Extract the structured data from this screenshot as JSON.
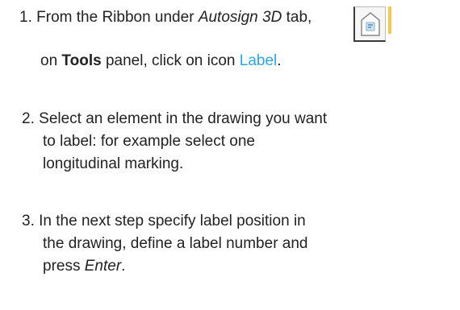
{
  "steps": [
    {
      "number": "1.",
      "line1_prefix": "From the Ribbon under ",
      "line1_tab": "Autosign 3D",
      "line1_suffix": " tab,",
      "line2_prefix": "on ",
      "line2_panel": "Tools",
      "line2_mid": " panel, click on icon ",
      "line2_link": "Label",
      "line2_end": ".",
      "icon": "label-tool-icon"
    },
    {
      "number": "2.",
      "line1": "Select an element in the drawing you want",
      "line2": "to label: for example select one",
      "line3": "longitudinal marking."
    },
    {
      "number": "3.",
      "line1": "In the next step specify label position in",
      "line2": "the drawing, define a label number and",
      "line3_prefix": "press ",
      "line3_key": "Enter",
      "line3_end": "."
    }
  ],
  "colors": {
    "text": "#222222",
    "accent": "#2aa7e0",
    "icon_yellow": "#f7c948"
  }
}
